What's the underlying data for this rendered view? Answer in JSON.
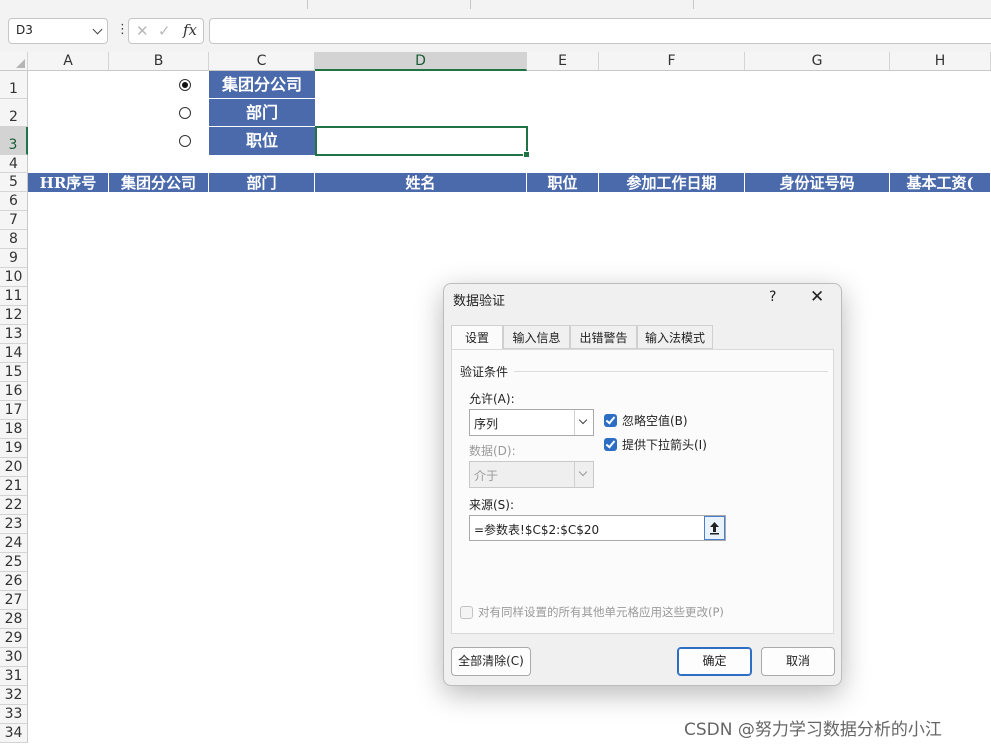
{
  "formula_bar": {
    "name_box": "D3",
    "more": "⋮",
    "cancel": "✕",
    "enter": "✓",
    "fx": "fx",
    "formula": ""
  },
  "columns": [
    "A",
    "B",
    "C",
    "D",
    "E",
    "F",
    "G",
    "H"
  ],
  "selected_column": "D",
  "rows": [
    "1",
    "2",
    "3",
    "4",
    "5",
    "6",
    "7",
    "8",
    "9",
    "10",
    "11",
    "12",
    "13",
    "14",
    "15",
    "16",
    "17",
    "18",
    "19",
    "20",
    "21",
    "22",
    "23",
    "24",
    "25",
    "26",
    "27",
    "28",
    "29",
    "30",
    "31",
    "32",
    "33",
    "34"
  ],
  "selected_row": "3",
  "cells": {
    "c1": "集团分公司",
    "c2": "部门",
    "c3": "职位"
  },
  "radios": [
    {
      "checked": true
    },
    {
      "checked": false
    },
    {
      "checked": false
    }
  ],
  "header_row": [
    "HR序号",
    "集团分公司",
    "部门",
    "姓名",
    "职位",
    "参加工作日期",
    "身份证号码",
    "基本工资("
  ],
  "colors": {
    "header_fill": "#4a6aab",
    "accent_green": "#217346",
    "dialog_accent": "#2d6ec4"
  },
  "dialog": {
    "title": "数据验证",
    "help": "?",
    "close": "✕",
    "tabs": [
      "设置",
      "输入信息",
      "出错警告",
      "输入法模式"
    ],
    "active_tab": "设置",
    "section": "验证条件",
    "allow_label": "允许(A):",
    "allow_value": "序列",
    "data_label": "数据(D):",
    "data_value": "介于",
    "ignore_blank": {
      "label": "忽略空值(B)",
      "checked": true
    },
    "dropdown": {
      "label": "提供下拉箭头(I)",
      "checked": true
    },
    "source_label": "来源(S):",
    "source_value": "=参数表!$C$2:$C$20",
    "apply_all": {
      "label": "对有同样设置的所有其他单元格应用这些更改(P)",
      "checked": false
    },
    "clear_all": "全部清除(C)",
    "ok": "确定",
    "cancel": "取消"
  },
  "watermark": "CSDN @努力学习数据分析的小江"
}
